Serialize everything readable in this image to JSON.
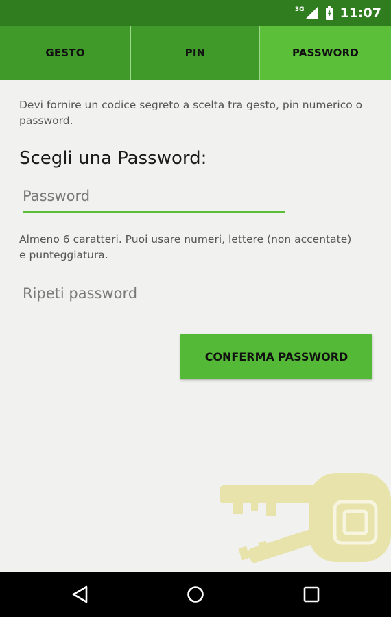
{
  "status_bar": {
    "network": "3G",
    "time": "11:07",
    "icons": [
      "signal-icon",
      "battery-icon"
    ]
  },
  "tabs": [
    {
      "label": "GESTO",
      "active": false
    },
    {
      "label": "PIN",
      "active": false
    },
    {
      "label": "PASSWORD",
      "active": true
    }
  ],
  "main": {
    "intro": "Devi fornire un codice segreto a scelta tra gesto, pin numerico o password.",
    "heading": "Scegli una Password:",
    "password_field": {
      "placeholder": "Password",
      "value": ""
    },
    "hint": "Almeno 6 caratteri. Puoi usare numeri, lettere (non accentate) e punteggiatura.",
    "repeat_field": {
      "placeholder": "Ripeti password",
      "value": ""
    },
    "confirm_label": "CONFERMA PASSWORD"
  },
  "nav_bar": {
    "icons": [
      "back-icon",
      "home-icon",
      "recent-apps-icon"
    ]
  },
  "colors": {
    "status_bar": "#2f7d1f",
    "tab_inactive": "#3f9a2a",
    "tab_active": "#5bbf3a",
    "accent": "#54b936",
    "background": "#f1f1ef",
    "keys_art": "#e6e1a0"
  }
}
